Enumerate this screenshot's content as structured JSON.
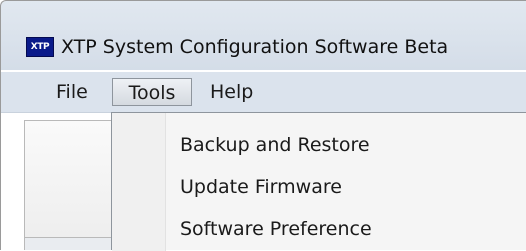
{
  "window": {
    "app_icon_text": "XTP",
    "title": "XTP System Configuration Software Beta"
  },
  "menubar": {
    "items": [
      {
        "label": "File"
      },
      {
        "label": "Tools"
      },
      {
        "label": "Help"
      }
    ],
    "open_menu": "Tools"
  },
  "tools_menu": {
    "items": [
      {
        "label": "Backup and Restore"
      },
      {
        "label": "Update Firmware"
      },
      {
        "label": "Software Preference"
      }
    ]
  },
  "colors": {
    "title_bar": "#dbe3ed",
    "menubar": "#dbe3ed",
    "dropdown_bg": "#f5f5f5",
    "app_icon_bg": "#0a1a8a"
  },
  "icons": {
    "app": "xtp-logo-icon"
  }
}
